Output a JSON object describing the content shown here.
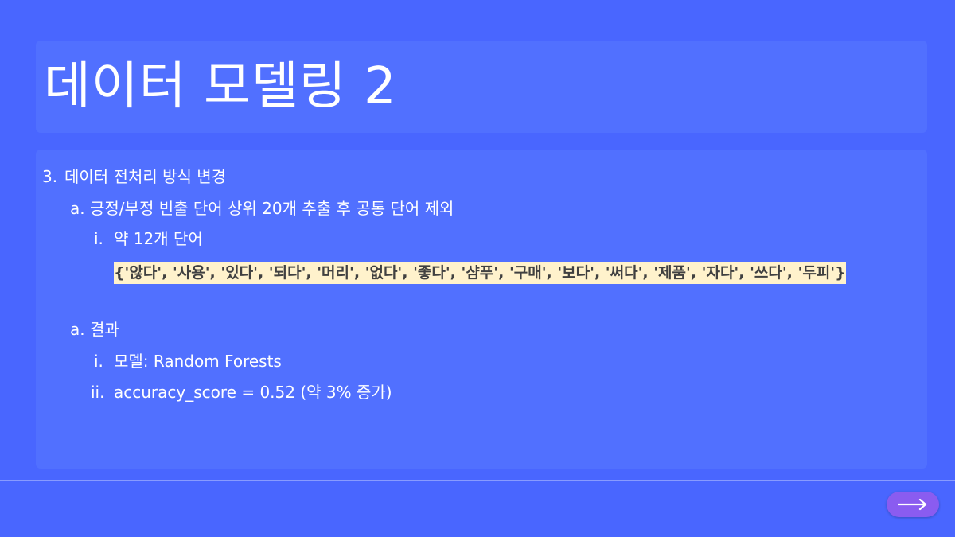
{
  "slide": {
    "title": "데이터 모델링 2",
    "items": {
      "section_number": "3.",
      "section_text": "데이터 전처리 방식 변경",
      "sub_a1_marker": "a.",
      "sub_a1_text": "긍정/부정 빈출 단어 상위 20개 추출 후 공통 단어 제외",
      "sub_i1_marker": "i.",
      "sub_i1_text": "약 12개 단어",
      "word_set": "{'않다', '사용', '있다', '되다', '머리', '없다', '좋다', '샴푸', '구매', '보다', '써다', '제품', '자다', '쓰다', '두피'}",
      "sub_a2_marker": "a.",
      "sub_a2_text": "결과",
      "sub_i2_marker": "i.",
      "sub_i2_text": "모델: Random Forests",
      "sub_ii2_marker": "ii.",
      "sub_ii2_text": "accuracy_score = 0.52 (약 3% 증가)"
    }
  },
  "navigation": {
    "next_icon": "arrow-right-icon"
  },
  "colors": {
    "background": "#4966ff",
    "panel": "#5170ff",
    "highlight": "#fff2cc",
    "button": "#8a5cf0"
  }
}
